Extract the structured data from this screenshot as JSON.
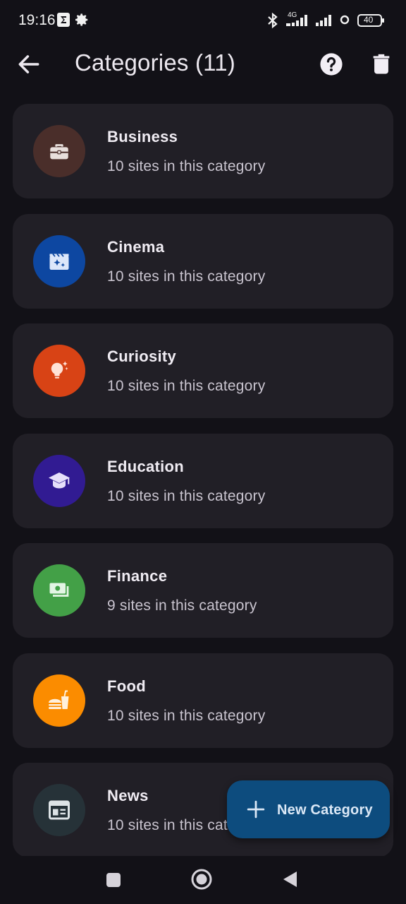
{
  "status_bar": {
    "time": "19:16",
    "network": "4G",
    "battery": "40"
  },
  "app_bar": {
    "title": "Categories (11)"
  },
  "categories": [
    {
      "name": "Business",
      "subtitle": "10 sites in this category",
      "color": "#4a2e2a",
      "icon": "briefcase-icon"
    },
    {
      "name": "Cinema",
      "subtitle": "10 sites in this category",
      "color": "#0d47a1",
      "icon": "movie-sparkle-icon"
    },
    {
      "name": "Curiosity",
      "subtitle": "10 sites in this category",
      "color": "#d84315",
      "icon": "lightbulb-sparkle-icon"
    },
    {
      "name": "Education",
      "subtitle": "10 sites in this category",
      "color": "#311b92",
      "icon": "school-icon"
    },
    {
      "name": "Finance",
      "subtitle": "9 sites in this category",
      "color": "#43a047",
      "icon": "payments-icon"
    },
    {
      "name": "Food",
      "subtitle": "10 sites in this category",
      "color": "#fb8c00",
      "icon": "fastfood-icon"
    },
    {
      "name": "News",
      "subtitle": "10 sites in this category",
      "color": "#263238",
      "icon": "newspaper-icon"
    }
  ],
  "fab": {
    "label": "New Category"
  },
  "colors": {
    "background": "#121117",
    "card": "#211f26",
    "fab": "#0d4c7e"
  }
}
